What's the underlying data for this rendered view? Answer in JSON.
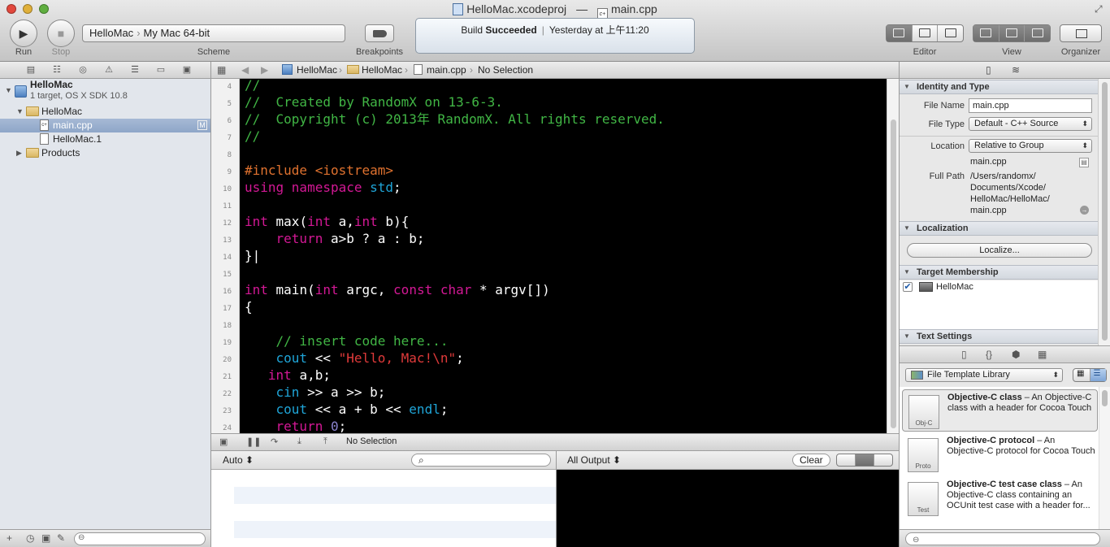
{
  "window": {
    "project_file": "HelloMac.xcodeproj",
    "dash": "—",
    "source_file": "main.cpp"
  },
  "toolbar": {
    "run_label": "Run",
    "stop_label": "Stop",
    "scheme_label": "Scheme",
    "scheme_target": "HelloMac",
    "scheme_destination": "My Mac 64-bit",
    "breakpoints_label": "Breakpoints",
    "editor_label": "Editor",
    "view_label": "View",
    "organizer_label": "Organizer"
  },
  "activity": {
    "status_prefix": "Build",
    "status_bold": "Succeeded",
    "time": "Yesterday at 上午11:20"
  },
  "navigator": {
    "project_name": "HelloMac",
    "project_sub": "1 target, OS X SDK 10.8",
    "group_name": "HelloMac",
    "file_main": "main.cpp",
    "file_main_badge": "M",
    "file_man": "HelloMac.1",
    "products": "Products"
  },
  "jumpbar": {
    "crumb1": "HelloMac",
    "crumb2": "HelloMac",
    "crumb3": "main.cpp",
    "crumb4": "No Selection"
  },
  "editor": {
    "lines": [
      {
        "n": "4",
        "segs": [
          {
            "c": "c-com",
            "t": "//"
          }
        ]
      },
      {
        "n": "5",
        "segs": [
          {
            "c": "c-com",
            "t": "//  Created by RandomX on 13-6-3."
          }
        ]
      },
      {
        "n": "6",
        "segs": [
          {
            "c": "c-com",
            "t": "//  Copyright (c) 2013年 RandomX. All rights reserved."
          }
        ]
      },
      {
        "n": "7",
        "segs": [
          {
            "c": "c-com",
            "t": "//"
          }
        ]
      },
      {
        "n": "8",
        "segs": []
      },
      {
        "n": "9",
        "segs": [
          {
            "c": "c-pre",
            "t": "#include <iostream>"
          }
        ]
      },
      {
        "n": "10",
        "segs": [
          {
            "c": "c-kw",
            "t": "using namespace "
          },
          {
            "c": "c-ty",
            "t": "std"
          },
          {
            "c": "",
            "t": ";"
          }
        ]
      },
      {
        "n": "11",
        "segs": []
      },
      {
        "n": "12",
        "segs": [
          {
            "c": "c-kw",
            "t": "int"
          },
          {
            "c": "",
            "t": " max("
          },
          {
            "c": "c-kw",
            "t": "int"
          },
          {
            "c": "",
            "t": " a,"
          },
          {
            "c": "c-kw",
            "t": "int"
          },
          {
            "c": "",
            "t": " b){"
          }
        ]
      },
      {
        "n": "13",
        "segs": [
          {
            "c": "",
            "t": "    "
          },
          {
            "c": "c-kw",
            "t": "return"
          },
          {
            "c": "",
            "t": " a>b ? a : b;"
          }
        ]
      },
      {
        "n": "14",
        "segs": [
          {
            "c": "",
            "t": "}|"
          }
        ]
      },
      {
        "n": "15",
        "segs": []
      },
      {
        "n": "16",
        "segs": [
          {
            "c": "c-kw",
            "t": "int"
          },
          {
            "c": "",
            "t": " main("
          },
          {
            "c": "c-kw",
            "t": "int"
          },
          {
            "c": "",
            "t": " argc, "
          },
          {
            "c": "c-kw",
            "t": "const char"
          },
          {
            "c": "",
            "t": " * argv[])"
          }
        ]
      },
      {
        "n": "17",
        "segs": [
          {
            "c": "",
            "t": "{"
          }
        ]
      },
      {
        "n": "18",
        "segs": []
      },
      {
        "n": "19",
        "segs": [
          {
            "c": "",
            "t": "    "
          },
          {
            "c": "c-com",
            "t": "// insert code here..."
          }
        ]
      },
      {
        "n": "20",
        "segs": [
          {
            "c": "",
            "t": "    "
          },
          {
            "c": "c-ty",
            "t": "cout"
          },
          {
            "c": "",
            "t": " << "
          },
          {
            "c": "c-str",
            "t": "\"Hello, Mac!\\n\""
          },
          {
            "c": "",
            "t": ";"
          }
        ]
      },
      {
        "n": "21",
        "segs": [
          {
            "c": "",
            "t": "   "
          },
          {
            "c": "c-kw",
            "t": "int"
          },
          {
            "c": "",
            "t": " a,b;"
          }
        ]
      },
      {
        "n": "22",
        "segs": [
          {
            "c": "",
            "t": "    "
          },
          {
            "c": "c-ty",
            "t": "cin"
          },
          {
            "c": "",
            "t": " >> a >> b;"
          }
        ]
      },
      {
        "n": "23",
        "segs": [
          {
            "c": "",
            "t": "    "
          },
          {
            "c": "c-ty",
            "t": "cout"
          },
          {
            "c": "",
            "t": " << a + b << "
          },
          {
            "c": "c-ty",
            "t": "endl"
          },
          {
            "c": "",
            "t": ";"
          }
        ]
      },
      {
        "n": "24",
        "segs": [
          {
            "c": "",
            "t": "    "
          },
          {
            "c": "c-kw",
            "t": "return"
          },
          {
            "c": "",
            "t": " "
          },
          {
            "c": "c-num",
            "t": "0"
          },
          {
            "c": "",
            "t": ";"
          }
        ]
      }
    ]
  },
  "debug": {
    "selection": "No Selection",
    "auto_label": "Auto",
    "output_label": "All Output",
    "clear_label": "Clear"
  },
  "inspector": {
    "identity_header": "Identity and Type",
    "file_name_label": "File Name",
    "file_name_value": "main.cpp",
    "file_type_label": "File Type",
    "file_type_value": "Default - C++ Source",
    "location_label": "Location",
    "location_value": "Relative to Group",
    "location_file": "main.cpp",
    "full_path_label": "Full Path",
    "full_path_1": "/Users/randomx/",
    "full_path_2": "Documents/Xcode/",
    "full_path_3": "HelloMac/HelloMac/",
    "full_path_4": "main.cpp",
    "localization_header": "Localization",
    "localize_button": "Localize...",
    "target_header": "Target Membership",
    "target_name": "HelloMac",
    "text_settings_header": "Text Settings"
  },
  "library": {
    "selector": "File Template Library",
    "items": [
      {
        "title": "Objective-C class",
        "desc": " – An Objective-C class with a header for Cocoa Touch",
        "badge": "Obj-C"
      },
      {
        "title": "Objective-C protocol",
        "desc": " – An Objective-C protocol for Cocoa Touch",
        "badge": "Proto"
      },
      {
        "title": "Objective-C test case class",
        "desc": " – An Objective-C class containing an OCUnit test case with a header for...",
        "badge": "Test"
      }
    ]
  },
  "colors": {
    "comment": "#41b645",
    "keyword": "#d31895",
    "type": "#1fa5d8",
    "string": "#e03a3a",
    "preprocessor": "#e0722f",
    "number": "#8b84cf",
    "editor_bg": "#000000",
    "selection": "#8ea6c8"
  }
}
